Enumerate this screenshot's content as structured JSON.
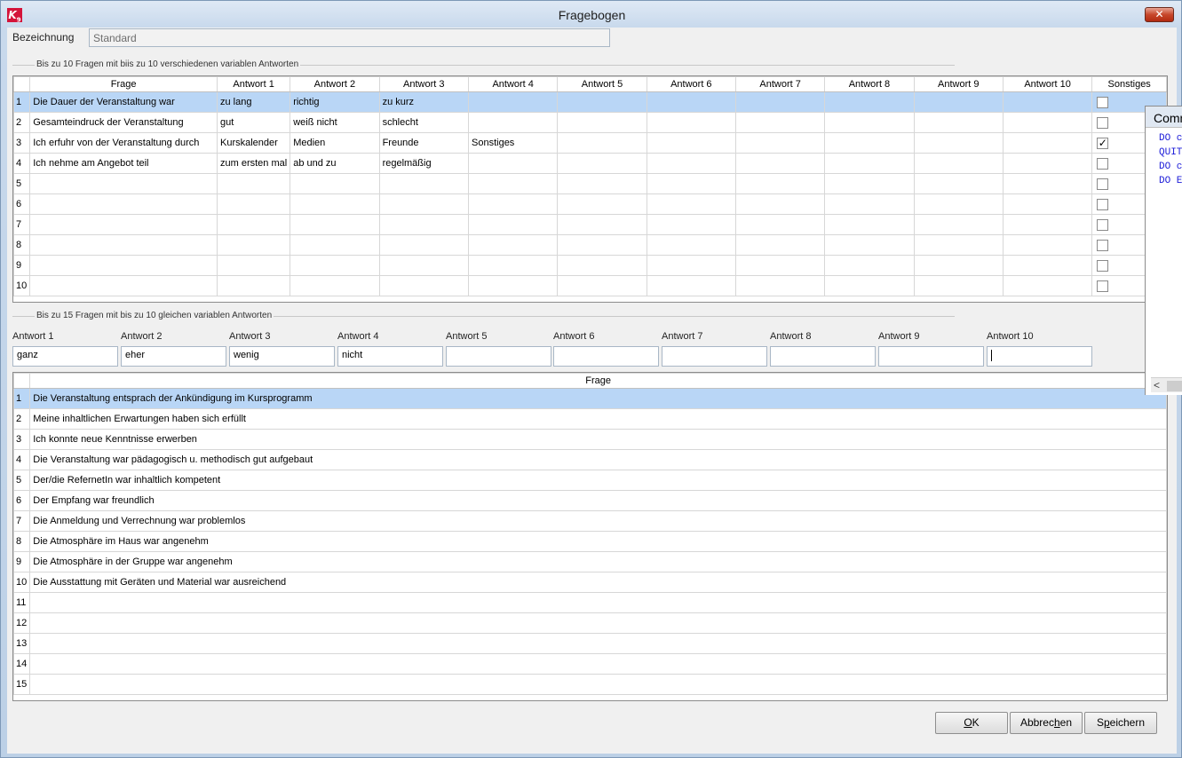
{
  "window": {
    "title": "Fragebogen",
    "close_label": "✕"
  },
  "bezeichnung": {
    "label": "Bezeichnung",
    "value": "Standard"
  },
  "section1": {
    "label": "Bis zu 10 Fragen mit biis zu 10 verschiedenen variablen Antworten",
    "headers": [
      "Frage",
      "Antwort 1",
      "Antwort 2",
      "Antwort 3",
      "Antwort 4",
      "Antwort 5",
      "Antwort 6",
      "Antwort 7",
      "Antwort 8",
      "Antwort 9",
      "Antwort 10",
      "Sonstiges"
    ],
    "rows": [
      {
        "num": "1",
        "cells": [
          "Die Dauer der Veranstaltung war",
          "zu lang",
          "richtig",
          "zu kurz",
          "",
          "",
          "",
          "",
          "",
          "",
          ""
        ],
        "sonstiges": false,
        "selected": true
      },
      {
        "num": "2",
        "cells": [
          "Gesamteindruck der Veranstaltung",
          "gut",
          "weiß nicht",
          "schlecht",
          "",
          "",
          "",
          "",
          "",
          "",
          ""
        ],
        "sonstiges": false,
        "selected": false
      },
      {
        "num": "3",
        "cells": [
          "Ich erfuhr von der Veranstaltung durch",
          "Kurskalender",
          "Medien",
          "Freunde",
          "Sonstiges",
          "",
          "",
          "",
          "",
          "",
          ""
        ],
        "sonstiges": true,
        "selected": false
      },
      {
        "num": "4",
        "cells": [
          "Ich nehme am Angebot teil",
          "zum ersten mal",
          "ab und zu",
          "regelmäßig",
          "",
          "",
          "",
          "",
          "",
          "",
          ""
        ],
        "sonstiges": false,
        "selected": false
      },
      {
        "num": "5",
        "cells": [
          "",
          "",
          "",
          "",
          "",
          "",
          "",
          "",
          "",
          "",
          ""
        ],
        "sonstiges": false,
        "selected": false
      },
      {
        "num": "6",
        "cells": [
          "",
          "",
          "",
          "",
          "",
          "",
          "",
          "",
          "",
          "",
          ""
        ],
        "sonstiges": false,
        "selected": false
      },
      {
        "num": "7",
        "cells": [
          "",
          "",
          "",
          "",
          "",
          "",
          "",
          "",
          "",
          "",
          ""
        ],
        "sonstiges": false,
        "selected": false
      },
      {
        "num": "8",
        "cells": [
          "",
          "",
          "",
          "",
          "",
          "",
          "",
          "",
          "",
          "",
          ""
        ],
        "sonstiges": false,
        "selected": false
      },
      {
        "num": "9",
        "cells": [
          "",
          "",
          "",
          "",
          "",
          "",
          "",
          "",
          "",
          "",
          ""
        ],
        "sonstiges": false,
        "selected": false
      },
      {
        "num": "10",
        "cells": [
          "",
          "",
          "",
          "",
          "",
          "",
          "",
          "",
          "",
          "",
          ""
        ],
        "sonstiges": false,
        "selected": false
      }
    ]
  },
  "section2": {
    "label": "Bis zu 15 Fragen mit bis zu 10 gleichen variablen Antworten",
    "answers": [
      {
        "label": "Antwort 1",
        "value": "ganz"
      },
      {
        "label": "Antwort 2",
        "value": "eher"
      },
      {
        "label": "Antwort 3",
        "value": "wenig"
      },
      {
        "label": "Antwort 4",
        "value": "nicht"
      },
      {
        "label": "Antwort 5",
        "value": ""
      },
      {
        "label": "Antwort 6",
        "value": ""
      },
      {
        "label": "Antwort 7",
        "value": ""
      },
      {
        "label": "Antwort 8",
        "value": ""
      },
      {
        "label": "Antwort 9",
        "value": ""
      },
      {
        "label": "Antwort 10",
        "value": ""
      }
    ],
    "header": "Frage",
    "rows": [
      {
        "num": "1",
        "text": "Die Veranstaltung entsprach der Ankündigung im Kursprogramm",
        "selected": true
      },
      {
        "num": "2",
        "text": "Meine inhaltlichen Erwartungen haben sich erfüllt",
        "selected": false
      },
      {
        "num": "3",
        "text": "Ich konnte neue Kenntnisse erwerben",
        "selected": false
      },
      {
        "num": "4",
        "text": "Die Veranstaltung war pädagogisch u. methodisch gut aufgebaut",
        "selected": false
      },
      {
        "num": "5",
        "text": "Der/die RefernetIn war inhaltlich kompetent",
        "selected": false
      },
      {
        "num": "6",
        "text": "Der Empfang war freundlich",
        "selected": false
      },
      {
        "num": "7",
        "text": "Die Anmeldung und Verrechnung war problemlos",
        "selected": false
      },
      {
        "num": "8",
        "text": "Die Atmosphäre im Haus war angenehm",
        "selected": false
      },
      {
        "num": "9",
        "text": "Die Atmosphäre in der Gruppe war angenehm",
        "selected": false
      },
      {
        "num": "10",
        "text": "Die Ausstattung mit Geräten und Material war ausreichend",
        "selected": false
      },
      {
        "num": "11",
        "text": "",
        "selected": false
      },
      {
        "num": "12",
        "text": "",
        "selected": false
      },
      {
        "num": "13",
        "text": "",
        "selected": false
      },
      {
        "num": "14",
        "text": "",
        "selected": false
      },
      {
        "num": "15",
        "text": "",
        "selected": false
      }
    ]
  },
  "buttons": {
    "ok": {
      "mnemonic": "O",
      "rest": "K"
    },
    "cancel": {
      "before": "Abbrec",
      "mnemonic": "h",
      "after": "en"
    },
    "save": {
      "before": "S",
      "mnemonic": "p",
      "after": "eichern"
    }
  },
  "side_panel": {
    "title": "Comm",
    "lines": [
      "DO c",
      "QUIT",
      "DO c",
      "DO E"
    ],
    "scroll_left": "<"
  },
  "colors": {
    "selection": "#b9d6f6",
    "code_text": "#1a1ad8",
    "close_button": "#c7472b"
  }
}
